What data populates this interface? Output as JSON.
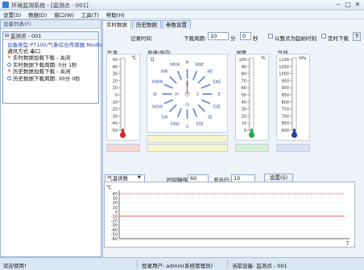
{
  "window": {
    "title": "环境监测系统 - [监测点 - 001]"
  },
  "menu": [
    "设置(S)",
    "数据(D)",
    "窗口(W)",
    "工具(T)",
    "帮助(H)"
  ],
  "left_panel": {
    "header": "设备列表(F)",
    "group_title": "监测点 - 001",
    "lines": [
      "设备类型:PT100/气象综合传感器 Modbus",
      "通讯方式:串口"
    ],
    "items": [
      {
        "icon": "x",
        "label": "实时数据加载下载 - 关闭"
      },
      {
        "icon": "o",
        "label": "实时数据下载周期: 0分 1秒"
      },
      {
        "icon": "x",
        "label": "历史数据加载下载 - 关闭"
      },
      {
        "icon": "o",
        "label": "历史数据下载周期: 30分 0秒"
      }
    ]
  },
  "tabs": [
    "实时数据",
    "历史数据",
    "参数设置"
  ],
  "controls": {
    "time_label": "记录时间",
    "period_label": "下载周期:",
    "period_value": "10",
    "minute_unit": "分",
    "second_value": "0",
    "second_unit": "秒",
    "check1_label": "以整点为起始时刻",
    "check2_label": "定时下载",
    "btn_label": "下"
  },
  "gauges": {
    "temp": {
      "label": "气温",
      "unit": "℃",
      "ticks": [
        "50",
        "40",
        "30",
        "20",
        "10",
        "0",
        "-10",
        "-20",
        "-30",
        "-40",
        "-50"
      ],
      "fill_fraction": 0.02,
      "bulb_color": "#d42b1d"
    },
    "wind": {
      "label": "风速/风向",
      "speed_label": "D",
      "directions": [
        "N",
        "NNE",
        "NE",
        "ENE",
        "E",
        "ESE",
        "SE",
        "SSE",
        "S",
        "SSW",
        "SW",
        "WSW",
        "W",
        "WNW",
        "NW",
        "NNW"
      ],
      "inner": [
        "北",
        "东",
        "南",
        "西"
      ]
    },
    "humidity": {
      "label": "湿度",
      "unit": "%",
      "ticks": [
        "100",
        "90",
        "80",
        "70",
        "60",
        "50",
        "40",
        "30",
        "20",
        "10",
        "0"
      ],
      "fill_fraction": 0.02,
      "bulb_color": "#25a74a"
    },
    "pressure": {
      "label": "气压",
      "unit": "hPa",
      "ticks": [
        "1100",
        "1050",
        "1000",
        "950",
        "900",
        "850",
        "800",
        "750",
        "700",
        "650",
        "600"
      ],
      "fill_fraction": 0.02,
      "bulb_color": "#2a3f9e"
    }
  },
  "chart_controls": {
    "param_value": "气温读数",
    "min_label": "时间轴值:",
    "min_value": "60",
    "step_label": "显示行:",
    "step_value": "10",
    "apply_label": "设置(S)"
  },
  "chart_data": {
    "type": "line",
    "ylabel": "℃",
    "xlabel": "T",
    "y_ticks": [
      40,
      30,
      20,
      10,
      0,
      -10,
      -20,
      -30,
      -40,
      -50,
      -60
    ],
    "ylim": [
      -60,
      40
    ],
    "upper_limit": 40,
    "lower_limit": -10,
    "series": []
  },
  "status": {
    "left": "欢迎使用!",
    "middle": "登录用户: admin(系统管理员)",
    "right": "当前设备: 监测点 - 001"
  },
  "colors": {
    "accent": "#3a7bd5",
    "limit_line": "#e03030",
    "temp_box": "#f7d6d6",
    "wind_box": "#f6f4c9",
    "humidity_box": "#d6f1d6",
    "pressure_box": "#d9e0f3"
  }
}
